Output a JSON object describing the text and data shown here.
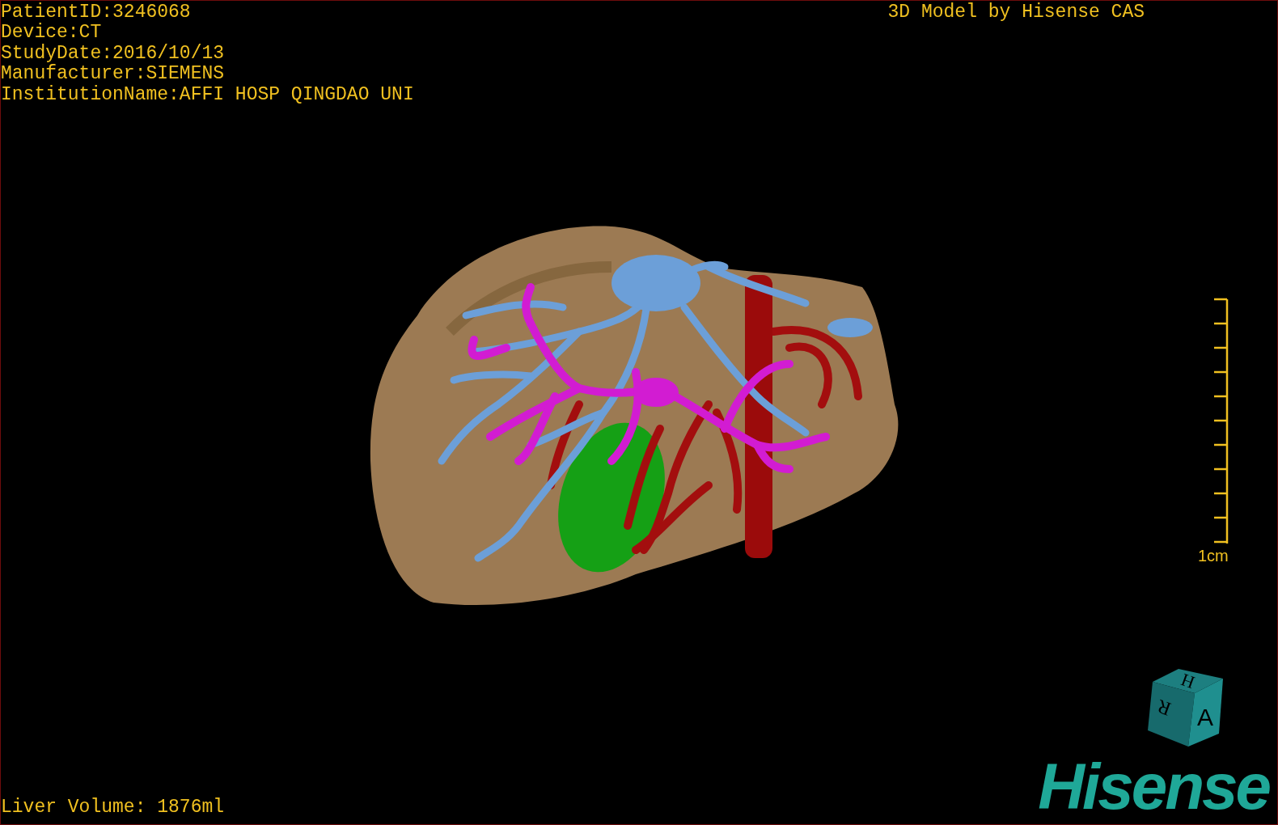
{
  "patient_info": [
    "PatientID:3246068",
    "Device:CT",
    "StudyDate:2016/10/13",
    "Manufacturer:SIEMENS",
    "InstitutionName:AFFI HOSP QINGDAO UNI"
  ],
  "title": "3D Model by Hisense CAS",
  "scale": {
    "label": "1cm"
  },
  "volume": "Liver Volume: 1876ml",
  "orientation_cube": {
    "top": "H",
    "side": "R",
    "front": "A"
  },
  "logo": "Hisense"
}
